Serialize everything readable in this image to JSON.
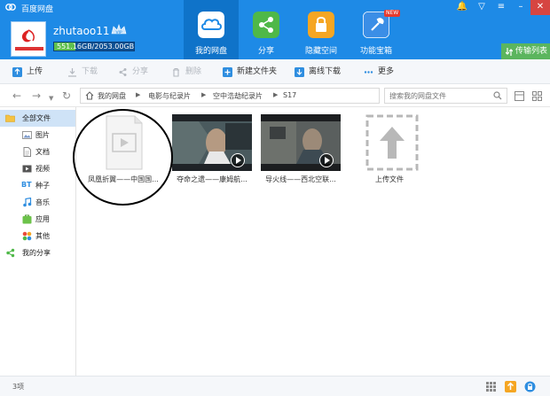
{
  "app": {
    "title": "百度网盘",
    "window_controls": [
      "bell-icon",
      "shirt-icon",
      "menu-icon",
      "minimize-icon",
      "maximize-icon",
      "close-icon"
    ]
  },
  "user": {
    "username": "zhutaoo11",
    "badge": "VIP",
    "quota_text": "551.16GB/2053.00GB",
    "quota_fraction": 0.268
  },
  "nav_tabs": [
    {
      "label": "我的网盘",
      "icon": "cloud-icon",
      "active": true
    },
    {
      "label": "分享",
      "icon": "share-icon",
      "active": false
    },
    {
      "label": "隐藏空间",
      "icon": "lock-icon",
      "active": false
    },
    {
      "label": "功能宝箱",
      "icon": "wrench-icon",
      "active": false,
      "badge": "NEW"
    }
  ],
  "transfer_list_label": "传输列表",
  "toolbar": {
    "upload": "上传",
    "download": "下载",
    "share": "分享",
    "delete": "删除",
    "new_folder": "新建文件夹",
    "offline_download": "离线下载",
    "more": "更多"
  },
  "breadcrumb": [
    "我的网盘",
    "电影与纪录片",
    "空中浩劫纪录片",
    "S17"
  ],
  "search": {
    "placeholder": "搜索我的网盘文件"
  },
  "sidebar": [
    {
      "label": "全部文件",
      "icon": "folder-icon",
      "active": true
    },
    {
      "label": "图片",
      "icon": "image-icon"
    },
    {
      "label": "文档",
      "icon": "document-icon"
    },
    {
      "label": "视频",
      "icon": "video-icon"
    },
    {
      "label": "种子",
      "icon": "bt-icon",
      "icon_text": "BT"
    },
    {
      "label": "音乐",
      "icon": "music-icon"
    },
    {
      "label": "应用",
      "icon": "app-icon"
    },
    {
      "label": "其他",
      "icon": "other-icon"
    },
    {
      "label": "我的分享",
      "icon": "share-icon"
    }
  ],
  "files": [
    {
      "name": "凤凰折翼——中国国...",
      "type": "video-placeholder"
    },
    {
      "name": "夺命之遗——康姆航...",
      "type": "video"
    },
    {
      "name": "导火线——西北空联...",
      "type": "video"
    }
  ],
  "upload_tile_label": "上传文件",
  "status": {
    "item_count": "3项"
  },
  "colors": {
    "header_blue": "#1e8ae6",
    "active_tab": "#0f73c9",
    "transfer_green": "#5bb55e",
    "sidebar_active": "#cfe3f7"
  }
}
